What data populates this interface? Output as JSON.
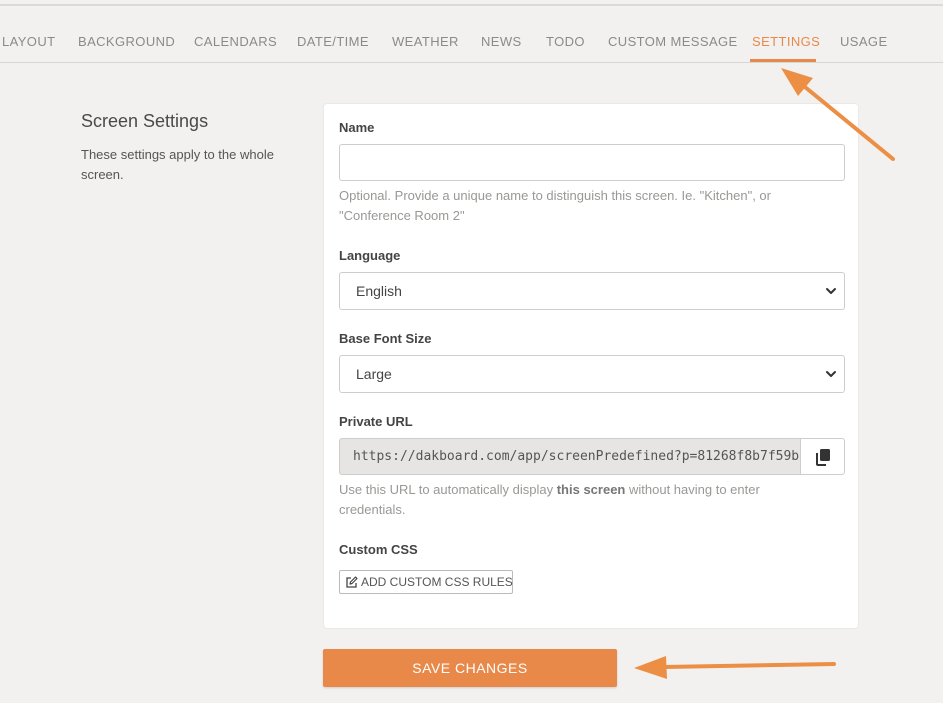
{
  "tabs": [
    {
      "label": "LAYOUT",
      "active": false
    },
    {
      "label": "BACKGROUND",
      "active": false
    },
    {
      "label": "CALENDARS",
      "active": false
    },
    {
      "label": "DATE/TIME",
      "active": false
    },
    {
      "label": "WEATHER",
      "active": false
    },
    {
      "label": "NEWS",
      "active": false
    },
    {
      "label": "TODO",
      "active": false
    },
    {
      "label": "CUSTOM MESSAGE",
      "active": false
    },
    {
      "label": "SETTINGS",
      "active": true
    },
    {
      "label": "USAGE",
      "active": false
    }
  ],
  "sidebar": {
    "title": "Screen Settings",
    "description": "These settings apply to the whole screen."
  },
  "form": {
    "name": {
      "label": "Name",
      "value": "",
      "help": "Optional. Provide a unique name to distinguish this screen. Ie. \"Kitchen\", or \"Conference Room 2\""
    },
    "language": {
      "label": "Language",
      "value": "English"
    },
    "font_size": {
      "label": "Base Font Size",
      "value": "Large"
    },
    "private_url": {
      "label": "Private URL",
      "value": "https://dakboard.com/app/screenPredefined?p=81268f8b7f59b",
      "help_before": "Use this URL to automatically display ",
      "help_bold": "this screen",
      "help_after": " without having to enter credentials."
    },
    "custom_css": {
      "label": "Custom CSS",
      "button_label": "ADD CUSTOM CSS RULES"
    }
  },
  "save_button": {
    "label": "SAVE CHANGES"
  },
  "colors": {
    "accent": "#e8894a",
    "background": "#f2f1ef",
    "card": "#ffffff",
    "readonly_field": "#e6e5e3"
  },
  "icons": {
    "select_caret": "chevron-down-icon",
    "copy": "copy-icon",
    "edit": "edit-icon",
    "annotation": "arrow-icon"
  }
}
